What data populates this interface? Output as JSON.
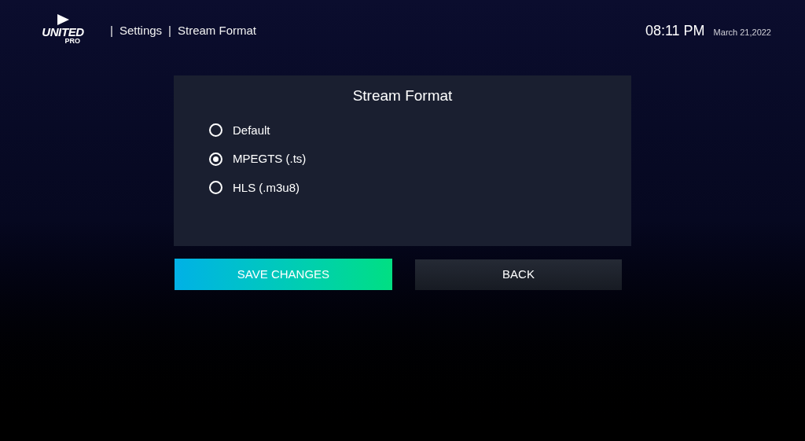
{
  "logo": {
    "title": "UNITED",
    "subtitle": "PRO"
  },
  "breadcrumb": [
    {
      "kind": "separator",
      "text": "|"
    },
    {
      "kind": "link",
      "text": "Settings"
    },
    {
      "kind": "separator",
      "text": "|"
    },
    {
      "kind": "link",
      "text": "Stream Format"
    }
  ],
  "clock": {
    "time": "08:11 PM",
    "date": "March 21,2022"
  },
  "panel": {
    "title": "Stream Format",
    "options": [
      {
        "label": "Default",
        "selected": false
      },
      {
        "label": "MPEGTS (.ts)",
        "selected": true
      },
      {
        "label": "HLS (.m3u8)",
        "selected": false
      }
    ]
  },
  "buttons": [
    {
      "kind": "primary",
      "label": "SAVE CHANGES"
    },
    {
      "kind": "secondary",
      "label": "BACK"
    }
  ]
}
